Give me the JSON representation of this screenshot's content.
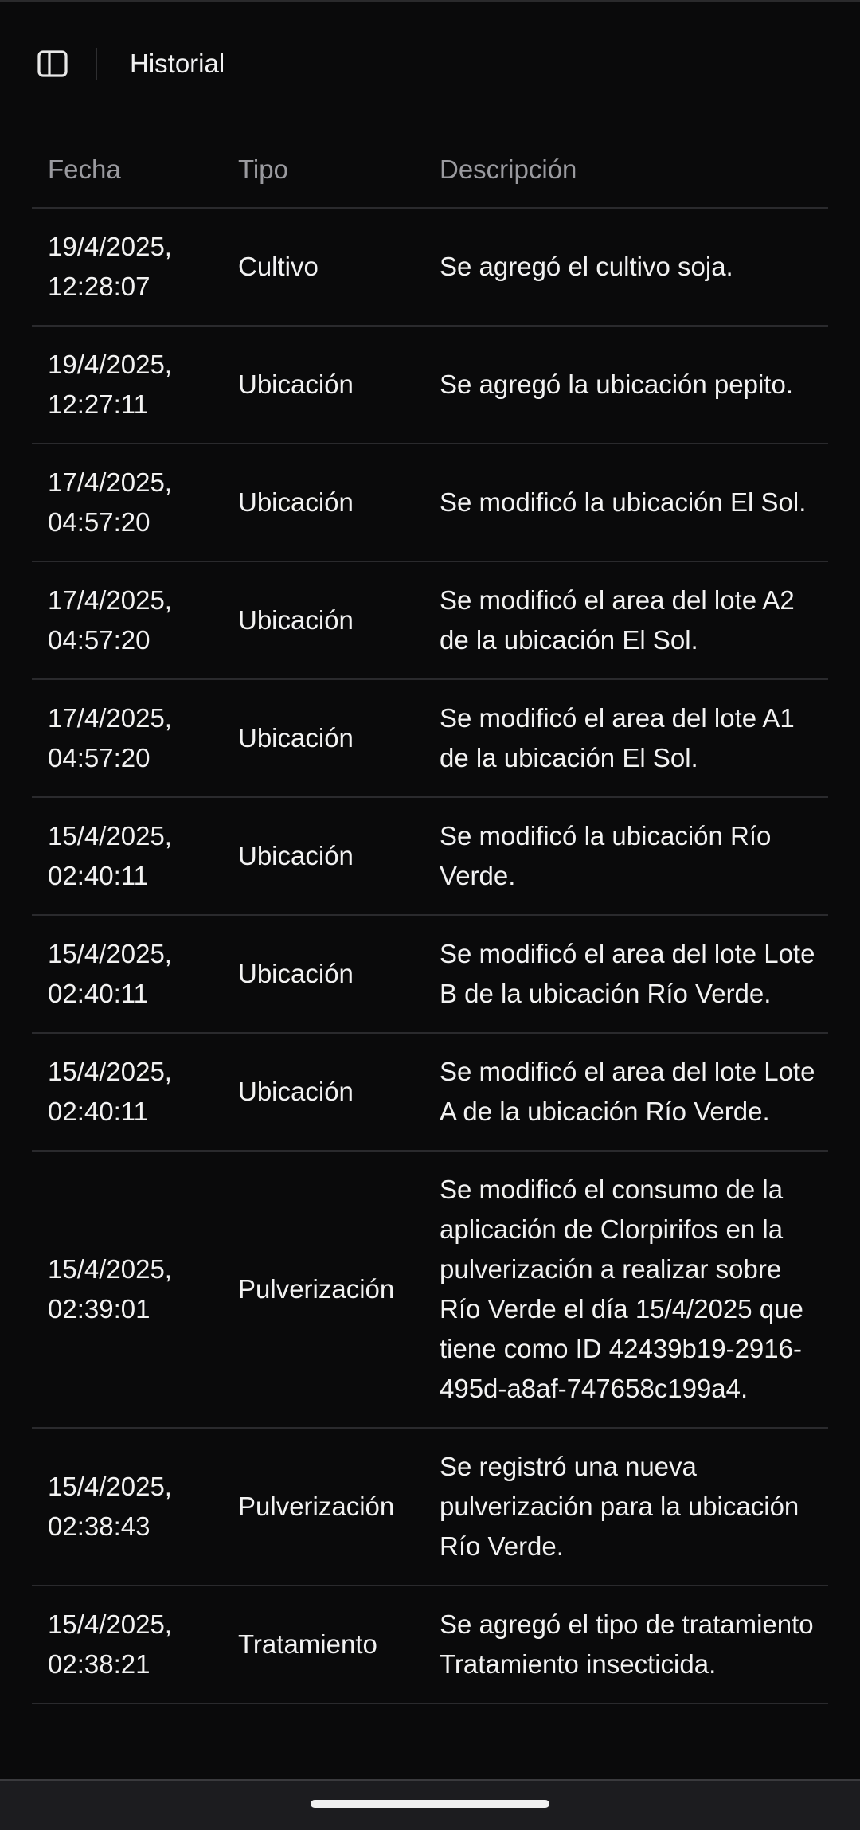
{
  "header": {
    "title": "Historial",
    "toggle_icon": "sidebar-panel-icon"
  },
  "table": {
    "columns": [
      "Fecha",
      "Tipo",
      "Descripción"
    ],
    "rows": [
      {
        "fecha": "19/4/2025, 12:28:07",
        "tipo": "Cultivo",
        "descripcion": "Se agregó el cultivo soja."
      },
      {
        "fecha": "19/4/2025, 12:27:11",
        "tipo": "Ubicación",
        "descripcion": "Se agregó la ubicación pepito."
      },
      {
        "fecha": "17/4/2025, 04:57:20",
        "tipo": "Ubicación",
        "descripcion": "Se modificó la ubicación El Sol."
      },
      {
        "fecha": "17/4/2025, 04:57:20",
        "tipo": "Ubicación",
        "descripcion": "Se modificó el area del lote A2 de la ubicación El Sol."
      },
      {
        "fecha": "17/4/2025, 04:57:20",
        "tipo": "Ubicación",
        "descripcion": "Se modificó el area del lote A1 de la ubicación El Sol."
      },
      {
        "fecha": "15/4/2025, 02:40:11",
        "tipo": "Ubicación",
        "descripcion": "Se modificó la ubicación Río Verde."
      },
      {
        "fecha": "15/4/2025, 02:40:11",
        "tipo": "Ubicación",
        "descripcion": "Se modificó el area del lote Lote B de la ubicación Río Verde."
      },
      {
        "fecha": "15/4/2025, 02:40:11",
        "tipo": "Ubicación",
        "descripcion": "Se modificó el area del lote Lote A de la ubicación Río Verde."
      },
      {
        "fecha": "15/4/2025, 02:39:01",
        "tipo": "Pulverización",
        "descripcion": "Se modificó el consumo de la aplicación de Clorpirifos en la pulverización a realizar sobre Río Verde el día 15/4/2025 que tiene como ID 42439b19-2916-495d-a8af-747658c199a4."
      },
      {
        "fecha": "15/4/2025, 02:38:43",
        "tipo": "Pulverización",
        "descripcion": "Se registró una nueva pulverización para la ubicación Río Verde."
      },
      {
        "fecha": "15/4/2025, 02:38:21",
        "tipo": "Tratamiento",
        "descripcion": "Se agregó el tipo de tratamiento Tratamiento insecticida."
      }
    ]
  },
  "colors": {
    "background": "#0a0a0b",
    "text": "#f2f2f2",
    "header_text": "#9a9a9f",
    "divider": "#2a2a2d"
  }
}
